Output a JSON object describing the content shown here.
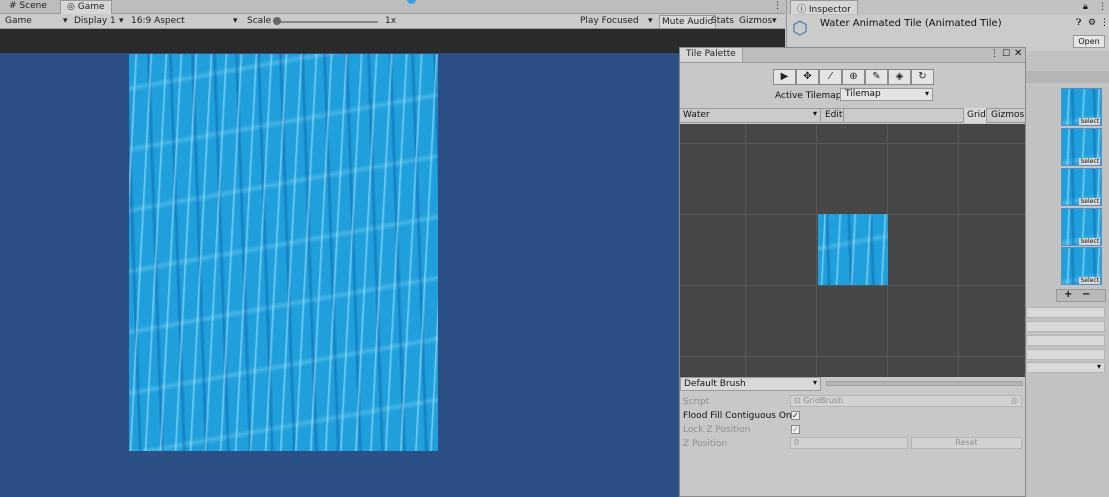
{
  "tabs": {
    "scene": "Scene",
    "game": "Game",
    "inspector": "Inspector"
  },
  "game_toolbar": {
    "mode": "Game",
    "display": "Display 1",
    "aspect": "16:9 Aspect",
    "scale_label": "Scale",
    "scale_value": "1x",
    "play_focused": "Play Focused",
    "mute_audio": "Mute Audio",
    "stats": "Stats",
    "gizmos": "Gizmos"
  },
  "inspector": {
    "title": "Water Animated Tile (Animated Tile)",
    "open_button": "Open",
    "select_label": "Select",
    "plus": "+",
    "minus": "−"
  },
  "tile_palette": {
    "title": "Tile Palette",
    "tools": [
      "▶",
      "✥",
      "⁄",
      "⊕",
      "✎",
      "◈",
      "↻"
    ],
    "active_tilemap_label": "Active Tilemap",
    "active_tilemap_value": "Tilemap",
    "palette": "Water",
    "edit": "Edit",
    "grid": "Grid",
    "gizmos": "Gizmos",
    "brush": "Default Brush",
    "script_label": "Script",
    "script_value": "GridBrush",
    "flood_fill_label": "Flood Fill Contiguous Only",
    "lock_z_label": "Lock Z Position",
    "z_position_label": "Z Position",
    "z_position_value": "0",
    "reset_button": "Reset"
  },
  "colors": {
    "water": "#1fa0dc",
    "game_bg": "#2c4f85",
    "palette_bg": "#464646"
  }
}
